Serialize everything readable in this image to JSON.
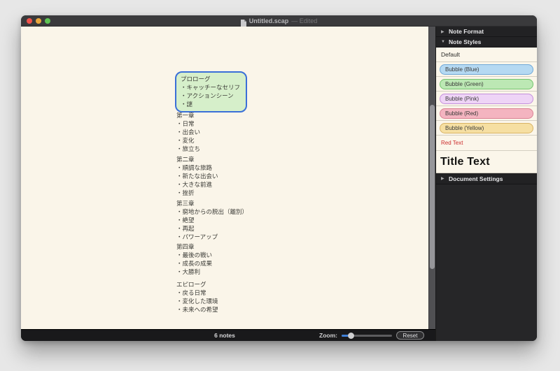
{
  "window": {
    "title": "Untitled.scap",
    "edited_suffix": "— Edited",
    "traffic_lights": [
      "close-button",
      "minimize-button",
      "zoom-button"
    ]
  },
  "canvas": {
    "background_color": "#faf5e9",
    "notes": [
      {
        "style": "bubble-green",
        "selected": true,
        "fill": "#d6efca",
        "selection_border": "#3a6fd8",
        "lines": [
          "プロローグ",
          "・キャッチーなセリフ",
          "・アクションシーン",
          "・謎"
        ]
      },
      {
        "style": "plain-text",
        "selected": false,
        "lines": [
          "第一章",
          "・日常",
          "・出会い",
          "・変化",
          "・旅立ち"
        ]
      },
      {
        "style": "plain-text",
        "selected": false,
        "lines": [
          "第二章",
          "・順調な旅路",
          "・新たな出会い",
          "・大きな前進",
          "・挫折"
        ]
      },
      {
        "style": "plain-text",
        "selected": false,
        "lines": [
          "第三章",
          "・窮地からの脱出（離別）",
          "・絶望",
          "・再起",
          "・パワーアップ"
        ]
      },
      {
        "style": "plain-text",
        "selected": false,
        "lines": [
          "第四章",
          "・最後の戦い",
          "・成長の成果",
          "・大勝利"
        ]
      },
      {
        "style": "plain-text",
        "selected": false,
        "lines": [
          "エピローグ",
          "・戻る日常",
          "・変化した環境",
          "・未来への希望"
        ]
      }
    ]
  },
  "sidebar": {
    "headers": {
      "note_format": "Note Format",
      "note_styles": "Note Styles",
      "document_settings": "Document Settings"
    },
    "styles": [
      {
        "label": "Default",
        "kind": "plain"
      },
      {
        "label": "Bubble (Blue)",
        "kind": "bubble",
        "fill": "#b5d9f2",
        "border": "#6fa8d8"
      },
      {
        "label": "Bubble (Green)",
        "kind": "bubble",
        "fill": "#bce8b4",
        "border": "#74c46e"
      },
      {
        "label": "Bubble (Pink)",
        "kind": "bubble",
        "fill": "#eed4f6",
        "border": "#c490dc"
      },
      {
        "label": "Bubble (Red)",
        "kind": "bubble",
        "fill": "#f4b4c0",
        "border": "#da8294"
      },
      {
        "label": "Bubble (Yellow)",
        "kind": "bubble",
        "fill": "#f6dfa2",
        "border": "#d8b365"
      },
      {
        "label": "Red Text",
        "kind": "red-text",
        "color": "#cc2b2b"
      },
      {
        "label": "Title Text",
        "kind": "title"
      }
    ]
  },
  "statusbar": {
    "note_count": "6 notes",
    "zoom_label": "Zoom:",
    "zoom_percent": 15,
    "reset_label": "Reset"
  },
  "colors": {
    "titlebar": "#3a3a3c",
    "sidebar_dark": "#262628",
    "statusbar": "#19191b",
    "canvas": "#faf5e9",
    "slider_accent": "#3f7fd6"
  }
}
